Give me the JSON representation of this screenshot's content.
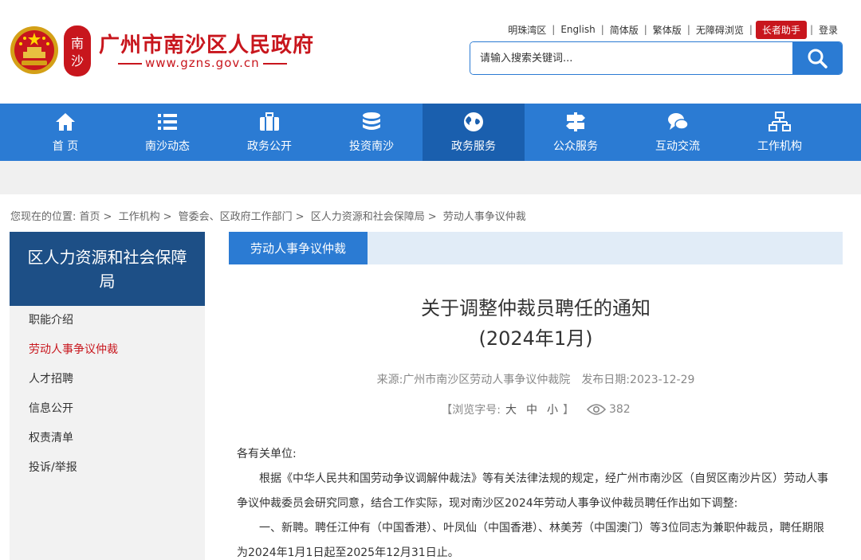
{
  "header": {
    "site_title": "广州市南沙区人民政府",
    "site_url": "www.gzns.gov.cn",
    "seal_text": "南沙",
    "toplinks": [
      "明珠湾区",
      "English",
      "简体版",
      "繁体版",
      "无障碍浏览"
    ],
    "elder_label": "长者助手",
    "login_label": "登录",
    "search_placeholder": "请输入搜索关键词...",
    "search_icon": "search-icon"
  },
  "nav": [
    {
      "label": "首 页",
      "icon": "home-icon"
    },
    {
      "label": "南沙动态",
      "icon": "list-icon"
    },
    {
      "label": "政务公开",
      "icon": "briefcase-icon"
    },
    {
      "label": "投资南沙",
      "icon": "coins-icon"
    },
    {
      "label": "政务服务",
      "icon": "globe-icon"
    },
    {
      "label": "公众服务",
      "icon": "signpost-icon"
    },
    {
      "label": "互动交流",
      "icon": "chat-icon"
    },
    {
      "label": "工作机构",
      "icon": "org-chart-icon"
    }
  ],
  "breadcrumb": {
    "prefix": "您现在的位置:",
    "items": [
      "首页",
      "工作机构",
      "管委会、区政府工作部门",
      "区人力资源和社会保障局",
      "劳动人事争议仲裁"
    ]
  },
  "sidebar": {
    "title": "区人力资源和社会保障局",
    "items": [
      "职能介绍",
      "劳动人事争议仲裁",
      "人才招聘",
      "信息公开",
      "权责清单",
      "投诉/举报"
    ]
  },
  "main": {
    "column_tab": "劳动人事争议仲裁",
    "title_line1": "关于调整仲裁员聘任的通知",
    "title_line2": "(2024年1月)",
    "source_label": "来源:",
    "source": "广州市南沙区劳动人事争议仲裁院",
    "date_label": "发布日期:",
    "date": "2023-12-29",
    "font_size_label": "【浏览字号:",
    "size_large": "大",
    "size_medium": "中",
    "size_small": "小",
    "font_size_end": "】",
    "views": "382",
    "para_greeting": "各有关单位:",
    "para_1": "根据《中华人民共和国劳动争议调解仲裁法》等有关法律法规的规定，经广州市南沙区（自贸区南沙片区）劳动人事争议仲裁委员会研究同意，结合工作实际，现对南沙区2024年劳动人事争议仲裁员聘任作出如下调整:",
    "para_2": "一、新聘。聘任江仲有（中国香港）、叶凤仙（中国香港）、林美芳（中国澳门）等3位同志为兼职仲裁员，聘任期限为2024年1月1日起至2025年12月31日止。"
  },
  "colors": {
    "brand_red": "#c8161d",
    "nav_blue": "#2b7bd3",
    "nav_active": "#1a5fae",
    "sidebar_title_bg": "#1d4f86"
  }
}
